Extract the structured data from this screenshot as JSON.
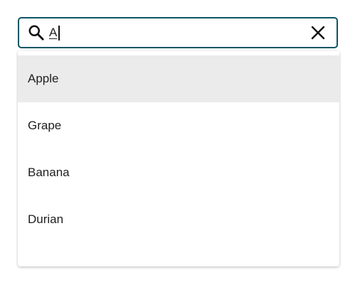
{
  "search": {
    "value": "A",
    "placeholder": ""
  },
  "icons": {
    "search": "search-icon",
    "clear": "close-icon"
  },
  "colors": {
    "border": "#0b5663",
    "highlight": "#ebebeb"
  },
  "options": [
    {
      "label": "Apple",
      "highlighted": true
    },
    {
      "label": "Grape",
      "highlighted": false
    },
    {
      "label": "Banana",
      "highlighted": false
    },
    {
      "label": "Durian",
      "highlighted": false
    }
  ]
}
